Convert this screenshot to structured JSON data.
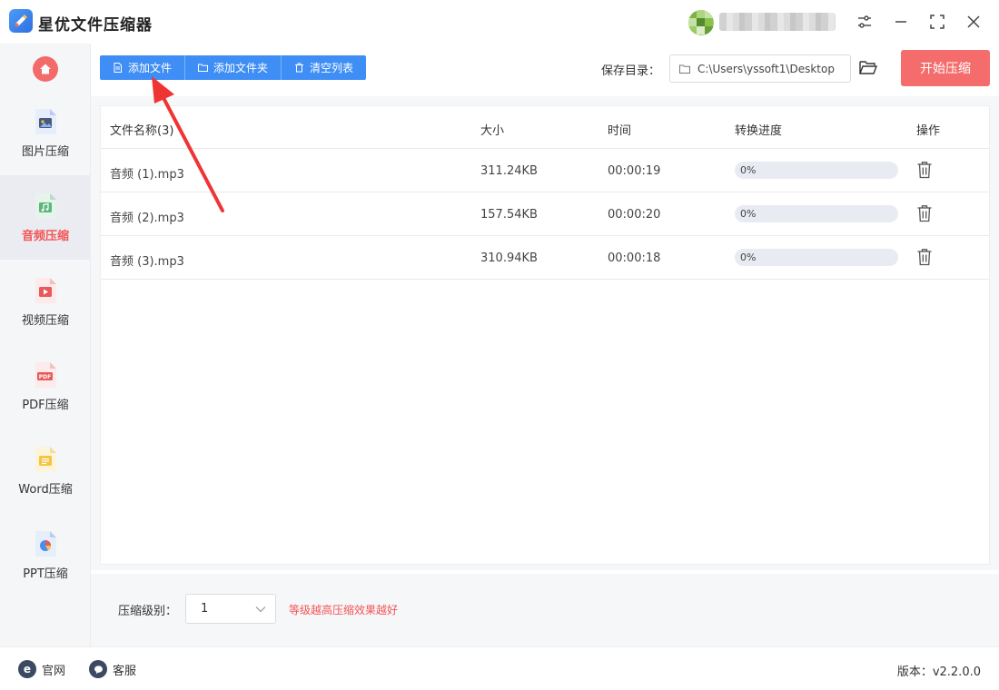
{
  "app": {
    "title": "星优文件压缩器",
    "accent": "#3f8ef5",
    "danger": "#f46c6c"
  },
  "sidebar": {
    "items": [
      {
        "label": "图片压缩",
        "icon": "image-icon",
        "active": false
      },
      {
        "label": "音频压缩",
        "icon": "audio-icon",
        "active": true
      },
      {
        "label": "视频压缩",
        "icon": "video-icon",
        "active": false
      },
      {
        "label": "PDF压缩",
        "icon": "pdf-icon",
        "active": false
      },
      {
        "label": "Word压缩",
        "icon": "word-icon",
        "active": false
      },
      {
        "label": "PPT压缩",
        "icon": "ppt-icon",
        "active": false
      }
    ]
  },
  "toolbar": {
    "add_file": "添加文件",
    "add_folder": "添加文件夹",
    "clear_list": "清空列表",
    "save_label": "保存目录：",
    "save_path": "C:\\Users\\yssoft1\\Desktop",
    "start": "开始压缩"
  },
  "table": {
    "headers": {
      "name": "文件名称(3)",
      "size": "大小",
      "time": "时间",
      "progress": "转换进度",
      "action": "操作"
    },
    "rows": [
      {
        "name": "音频 (1).mp3",
        "size": "311.24KB",
        "time": "00:00:19",
        "progress": "0%",
        "progress_value": 0
      },
      {
        "name": "音频 (2).mp3",
        "size": "157.54KB",
        "time": "00:00:20",
        "progress": "0%",
        "progress_value": 0
      },
      {
        "name": "音频 (3).mp3",
        "size": "310.94KB",
        "time": "00:00:18",
        "progress": "0%",
        "progress_value": 0
      }
    ]
  },
  "settings": {
    "level_label": "压缩级别：",
    "level_value": "1",
    "level_hint": "等级越高压缩效果越好"
  },
  "footer": {
    "website": "官网",
    "support": "客服",
    "version": "版本：v2.2.0.0"
  }
}
